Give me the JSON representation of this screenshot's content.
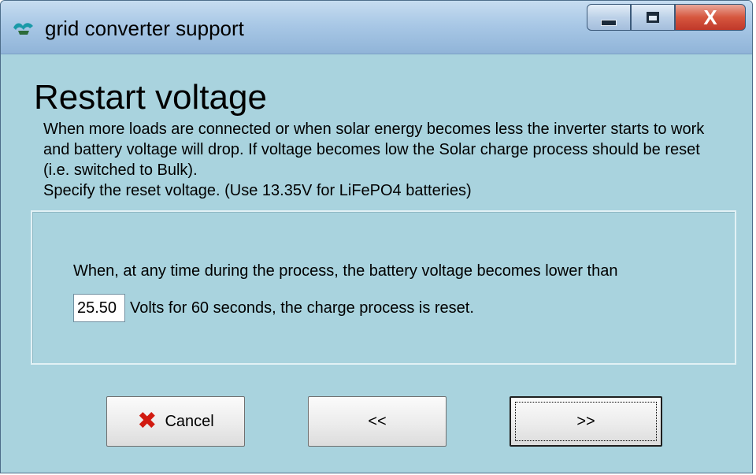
{
  "window": {
    "title": "grid converter support",
    "controls": {
      "minimize_icon": "minimize-icon",
      "maximize_icon": "maximize-icon",
      "close_label": "X"
    }
  },
  "page": {
    "heading": "Restart voltage",
    "description": [
      "When more loads are connected or when solar energy becomes less the inverter starts to work and battery voltage will drop. If voltage becomes low the Solar charge process should be reset (i.e. switched to Bulk).",
      "Specify the reset voltage. (Use 13.35V for LiFePO4 batteries)"
    ]
  },
  "panel": {
    "line1": "When, at any time during the process, the battery voltage becomes lower than",
    "voltage_value": "25.50",
    "line2_suffix": "Volts for 60 seconds, the charge process is reset."
  },
  "buttons": {
    "cancel": {
      "label": "Cancel",
      "icon": "red-x-icon"
    },
    "back": {
      "label": "<<"
    },
    "next": {
      "label": ">>"
    }
  },
  "colors": {
    "background": "#a9d3de",
    "cancel_icon": "#d11a10",
    "close_button": "#c0382a"
  }
}
